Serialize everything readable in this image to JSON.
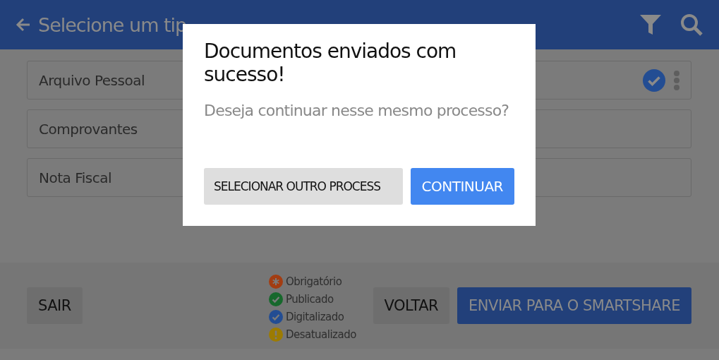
{
  "header": {
    "title": "Selecione um tip"
  },
  "document_types": [
    {
      "label": "Arquivo Pessoal",
      "checked": true
    },
    {
      "label": "Comprovantes",
      "checked": false
    },
    {
      "label": "Nota Fiscal",
      "checked": false
    }
  ],
  "legend": [
    {
      "label": "Obrigatório",
      "kind": "asterisk",
      "color": "#a33d12"
    },
    {
      "label": "Publicado",
      "kind": "check",
      "color": "#17682c"
    },
    {
      "label": "Digitalizado",
      "kind": "check",
      "color": "#234d93"
    },
    {
      "label": "Desatualizado",
      "kind": "exclamation",
      "color": "#9c7b02"
    }
  ],
  "footer": {
    "exit": "SAIR",
    "back": "VOLTAR",
    "send": "ENVIAR PARA O SMARTSHARE"
  },
  "dialog": {
    "title": "Documentos enviados com sucesso!",
    "message": "Deseja continuar nesse mesmo processo?",
    "buttons": [
      {
        "label": "SELECIONAR OUTRO PROCESS",
        "kind": "secondary"
      },
      {
        "label": "CONTINUAR",
        "kind": "primary"
      }
    ]
  }
}
